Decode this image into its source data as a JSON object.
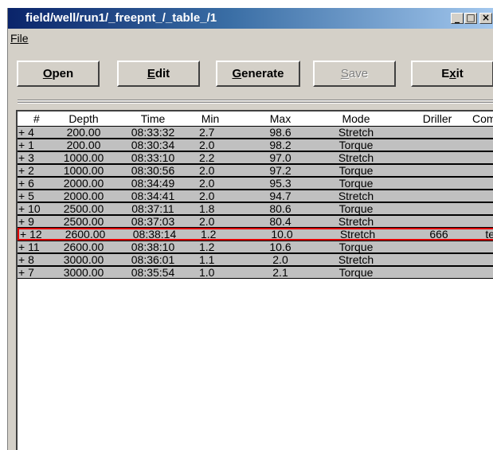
{
  "window": {
    "title": "field/well/run1/_freepnt_/_table_/1"
  },
  "menu": {
    "file_label": "File"
  },
  "toolbar": {
    "open": {
      "hotkey": "O",
      "rest": "pen"
    },
    "edit": {
      "hotkey": "E",
      "rest": "dit"
    },
    "generate": {
      "hotkey": "G",
      "rest": "enerate"
    },
    "save": {
      "hotkey": "S",
      "rest": "ave"
    },
    "exit": {
      "pre": "E",
      "hotkey": "x",
      "rest": "it"
    }
  },
  "table": {
    "columns": [
      "#",
      "Depth",
      "Time",
      "Min",
      "Max",
      "Mode",
      "Driller",
      "Com"
    ],
    "rows": [
      {
        "idx": "+ 4",
        "depth": "200.00",
        "time": "08:33:32",
        "min": "2.7",
        "max": "98.6",
        "mode": "Stretch",
        "driller": "",
        "comment": ""
      },
      {
        "idx": "+ 1",
        "depth": "200.00",
        "time": "08:30:34",
        "min": "2.0",
        "max": "98.2",
        "mode": "Torque",
        "driller": "",
        "comment": ""
      },
      {
        "idx": "+ 3",
        "depth": "1000.00",
        "time": "08:33:10",
        "min": "2.2",
        "max": "97.0",
        "mode": "Stretch",
        "driller": "",
        "comment": ""
      },
      {
        "idx": "+ 2",
        "depth": "1000.00",
        "time": "08:30:56",
        "min": "2.0",
        "max": "97.2",
        "mode": "Torque",
        "driller": "",
        "comment": ""
      },
      {
        "idx": "+ 6",
        "depth": "2000.00",
        "time": "08:34:49",
        "min": "2.0",
        "max": "95.3",
        "mode": "Torque",
        "driller": "",
        "comment": ""
      },
      {
        "idx": "+ 5",
        "depth": "2000.00",
        "time": "08:34:41",
        "min": "2.0",
        "max": "94.7",
        "mode": "Stretch",
        "driller": "",
        "comment": ""
      },
      {
        "idx": "+ 10",
        "depth": "2500.00",
        "time": "08:37:11",
        "min": "1.8",
        "max": "80.6",
        "mode": "Torque",
        "driller": "",
        "comment": ""
      },
      {
        "idx": "+ 9",
        "depth": "2500.00",
        "time": "08:37:03",
        "min": "2.0",
        "max": "80.4",
        "mode": "Stretch",
        "driller": "",
        "comment": ""
      },
      {
        "idx": "+ 12",
        "depth": "2600.00",
        "time": "08:38:14",
        "min": "1.2",
        "max": "10.0",
        "mode": "Stretch",
        "driller": "666",
        "comment": "test",
        "selected": true
      },
      {
        "idx": "+ 11",
        "depth": "2600.00",
        "time": "08:38:10",
        "min": "1.2",
        "max": "10.6",
        "mode": "Torque",
        "driller": "",
        "comment": ""
      },
      {
        "idx": "+ 8",
        "depth": "3000.00",
        "time": "08:36:01",
        "min": "1.1",
        "max": "2.0",
        "mode": "Stretch",
        "driller": "",
        "comment": ""
      },
      {
        "idx": "+ 7",
        "depth": "3000.00",
        "time": "08:35:54",
        "min": "1.0",
        "max": "2.1",
        "mode": "Torque",
        "driller": "",
        "comment": ""
      }
    ]
  }
}
